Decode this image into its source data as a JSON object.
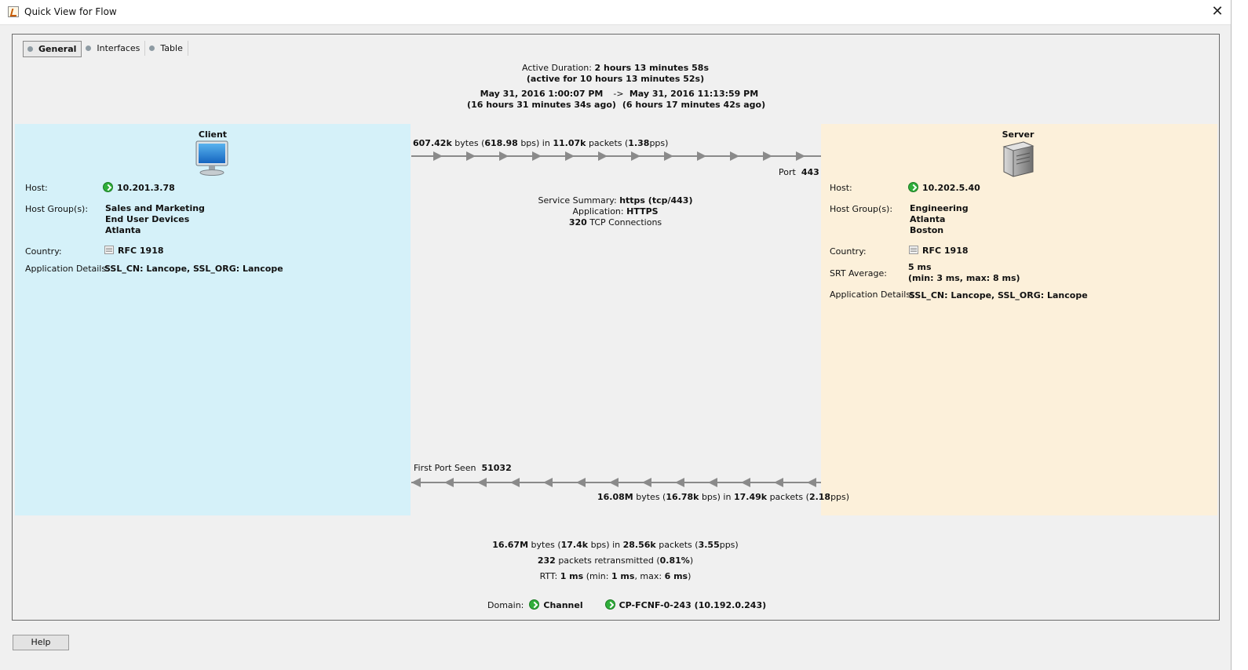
{
  "window": {
    "title": "Quick View for Flow",
    "close_glyph": "✕"
  },
  "tabs": [
    {
      "label": "General",
      "active": true
    },
    {
      "label": "Interfaces",
      "active": false
    },
    {
      "label": "Table",
      "active": false
    }
  ],
  "timing": {
    "active_duration_label": "Active Duration:",
    "active_duration": "2 hours 13 minutes 58s",
    "active_for": "(active for 10 hours 13 minutes 52s)",
    "start": "May 31, 2016 1:00:07 PM",
    "arrow": "->",
    "end": "May 31, 2016 11:13:59 PM",
    "start_ago": "(16 hours 31 minutes 34s ago)",
    "end_ago": "(6 hours 17 minutes 42s ago)"
  },
  "client": {
    "title": "Client",
    "host_label": "Host:",
    "host": "10.201.3.78",
    "host_groups_label": "Host Group(s):",
    "host_groups": [
      "Sales and Marketing",
      "End User Devices",
      "Atlanta"
    ],
    "country_label": "Country:",
    "country": "RFC 1918",
    "app_details_label": "Application Details:",
    "app_details": "SSL_CN: Lancope, SSL_ORG: Lancope"
  },
  "server": {
    "title": "Server",
    "host_label": "Host:",
    "host": "10.202.5.40",
    "host_groups_label": "Host Group(s):",
    "host_groups": [
      "Engineering",
      "Atlanta",
      "Boston"
    ],
    "country_label": "Country:",
    "country": "RFC 1918",
    "srt_label": "SRT Average:",
    "srt_avg": "5 ms",
    "srt_range": "(min: 3 ms, max: 8 ms)",
    "app_details_label": "Application Details:",
    "app_details": "SSL_CN: Lancope, SSL_ORG: Lancope"
  },
  "to_server": {
    "bytes": "607.42k",
    "bytes_word": "bytes (",
    "bps": "618.98",
    "bps_word": "bps) in",
    "packets": "11.07k",
    "packets_word": "packets (",
    "pps": "1.38",
    "pps_word": "pps)",
    "port_label": "Port",
    "port": "443"
  },
  "to_client": {
    "first_port_label": "First Port Seen",
    "first_port": "51032",
    "bytes": "16.08M",
    "bytes_word": "bytes (",
    "bps": "16.78k",
    "bps_word": "bps) in",
    "packets": "17.49k",
    "packets_word": "packets (",
    "pps": "2.18",
    "pps_word": "pps)"
  },
  "service": {
    "summary_label": "Service Summary:",
    "summary": "https (tcp/443)",
    "application_label": "Application:",
    "application": "HTTPS",
    "connections": "320",
    "connections_word": "TCP Connections"
  },
  "totals": {
    "bytes": "16.67M",
    "bytes_word": "bytes (",
    "bps": "17.4k",
    "bps_word": "bps) in",
    "packets": "28.56k",
    "packets_word": "packets (",
    "pps": "3.55",
    "pps_word": "pps)",
    "retransmitted": "232",
    "retransmitted_word": "packets retransmitted (",
    "retransmitted_pct": "0.81%",
    "close_paren": ")",
    "rtt_label": "RTT:",
    "rtt": "1 ms",
    "rtt_min_label": "(min:",
    "rtt_min": "1 ms",
    "rtt_max_label": ", max:",
    "rtt_max": "6 ms",
    "rtt_close": ")"
  },
  "domain": {
    "label": "Domain:",
    "name": "Channel",
    "device": "CP-FCNF-0-243 (10.192.0.243)"
  },
  "help_label": "Help",
  "colors": {
    "client_bg": "#d5f1f9",
    "server_bg": "#fcf0da",
    "arrow": "#8a8a8a"
  }
}
